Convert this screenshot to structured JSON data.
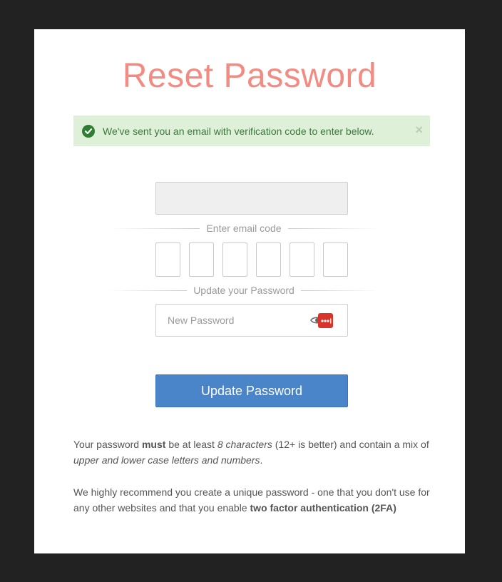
{
  "page": {
    "title": "Reset Password",
    "colors": {
      "title": "#f28b82",
      "alert_bg": "#dff0d8",
      "alert_text": "#3c763d",
      "button": "#4a85c9"
    }
  },
  "alert": {
    "message": "We've sent you an email with verification code to enter below.",
    "icon": "check-circle-icon",
    "close_label": "×"
  },
  "email_code_section": {
    "divider_label": "Enter email code",
    "digits": [
      "",
      "",
      "",
      "",
      "",
      ""
    ]
  },
  "password_section": {
    "divider_label": "Update your Password",
    "new_password": {
      "value": "",
      "placeholder": "New Password"
    },
    "icons": [
      "eye-icon",
      "password-manager-icon"
    ]
  },
  "submit": {
    "label": "Update Password"
  },
  "info": {
    "p1": {
      "t1": "Your password ",
      "b1": "must",
      "t2": " be at least ",
      "i1": "8 characters",
      "t3": " (12+ is better) and contain a mix of ",
      "i2": "upper and lower case letters and numbers",
      "t4": "."
    },
    "p2": {
      "t1": "We highly recommend you create a unique password - one that you don't use for any other websites and that you enable ",
      "b1": "two factor authentication (2FA)"
    }
  }
}
